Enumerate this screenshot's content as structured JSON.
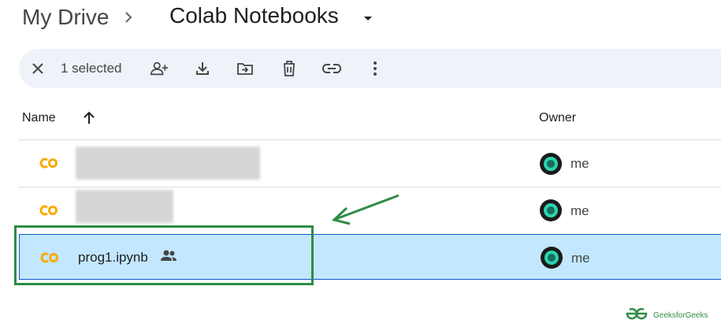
{
  "breadcrumb": {
    "root": "My Drive",
    "current": "Colab Notebooks"
  },
  "toolbar": {
    "selection_count": "1 selected",
    "icons": [
      "close-icon",
      "share-icon",
      "download-icon",
      "move-icon",
      "delete-icon",
      "link-icon",
      "more-vert-icon"
    ]
  },
  "columns": {
    "name": "Name",
    "owner": "Owner"
  },
  "files": [
    {
      "name": "",
      "owner": "me",
      "selected": false,
      "name_redacted": true
    },
    {
      "name": "",
      "owner": "me",
      "selected": false,
      "name_redacted": true
    },
    {
      "name": "prog1.ipynb",
      "owner": "me",
      "selected": true,
      "shared": true
    }
  ],
  "watermark": {
    "text": "GeeksforGeeks"
  },
  "colors": {
    "selected_row": "#c2e7ff",
    "toolbar_bg": "#eef2f9",
    "annotation": "#2e8b46",
    "colab_orange": "#f9ab00",
    "colab_yellow": "#f9ab00"
  }
}
